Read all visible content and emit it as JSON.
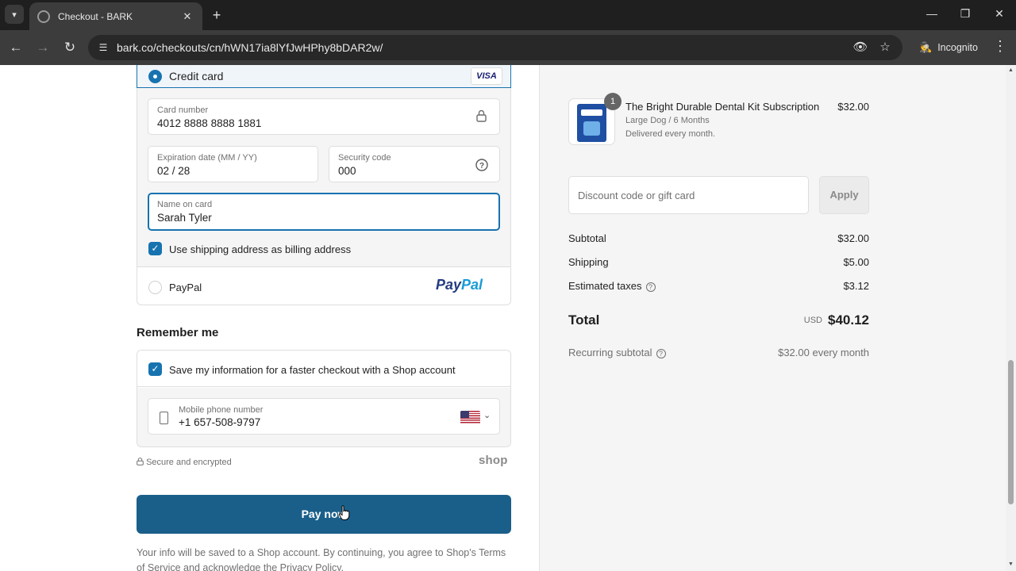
{
  "browser": {
    "tab_title": "Checkout - BARK",
    "url": "bark.co/checkouts/cn/hWN17ia8lYfJwHPhy8bDAR2w/",
    "incognito_label": "Incognito"
  },
  "payment": {
    "credit_card_label": "Credit card",
    "card_brand": "VISA",
    "card_number_label": "Card number",
    "card_number": "4012 8888 8888 1881",
    "expiration_label": "Expiration date (MM / YY)",
    "expiration": "02 / 28",
    "security_label": "Security code",
    "security_code": "000",
    "name_label": "Name on card",
    "name": "Sarah Tyler",
    "billing_checkbox_label": "Use shipping address as billing address",
    "billing_checked": true,
    "paypal_label": "PayPal",
    "paypal_logo_p": "Pay",
    "paypal_logo_pal": "Pal"
  },
  "remember": {
    "title": "Remember me",
    "save_label": "Save my information for a faster checkout with a Shop account",
    "save_checked": true,
    "phone_label": "Mobile phone number",
    "phone_value": "+1 657-508-9797"
  },
  "footer": {
    "secure_text": "Secure and encrypted",
    "shop_logo": "shop",
    "pay_button": "Pay now",
    "disclaimer": "Your info will be saved to a Shop account. By continuing, you agree to Shop's Terms of Service and acknowledge the Privacy Policy."
  },
  "order": {
    "quantity": "1",
    "product_name": "The Bright Durable Dental Kit Subscription",
    "variant": "Large Dog / 6 Months",
    "delivery": "Delivered every month.",
    "price": "$32.00",
    "discount_placeholder": "Discount code or gift card",
    "apply_label": "Apply",
    "subtotal_label": "Subtotal",
    "subtotal_value": "$32.00",
    "shipping_label": "Shipping",
    "shipping_value": "$5.00",
    "taxes_label": "Estimated taxes",
    "taxes_value": "$3.12",
    "total_label": "Total",
    "total_currency": "USD",
    "total_value": "$40.12",
    "recurring_label": "Recurring subtotal",
    "recurring_value": "$32.00 every month"
  },
  "colors": {
    "accent": "#1773b0",
    "pay_button": "#1a5f8a",
    "panel_bg": "#f5f5f5"
  }
}
